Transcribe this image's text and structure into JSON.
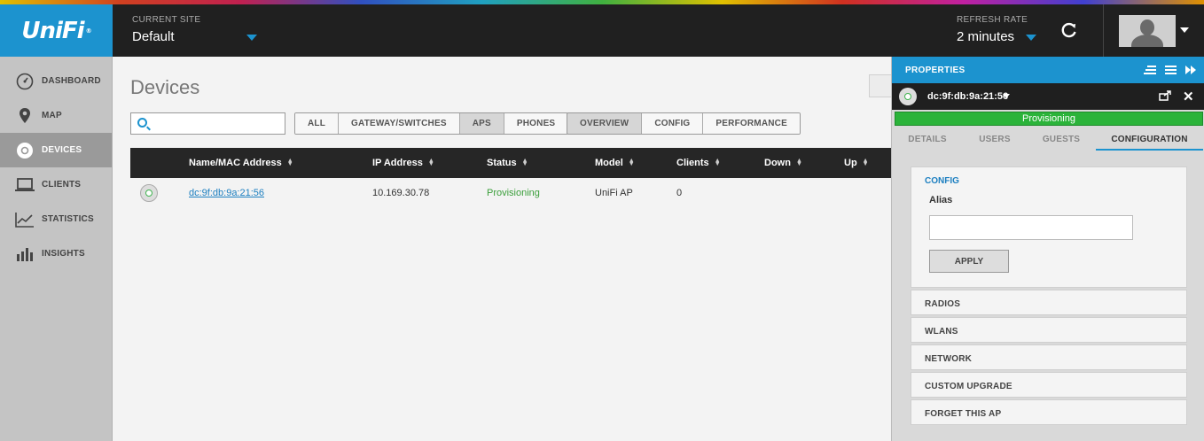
{
  "header": {
    "logo": "UniFi",
    "logo_mark": "®",
    "site_caption": "CURRENT SITE",
    "site_value": "Default",
    "refresh_caption": "REFRESH RATE",
    "refresh_value": "2 minutes",
    "refresh_icon": "refresh-icon",
    "accent": "#1c93cf"
  },
  "sidebar": {
    "items": [
      {
        "label": "DASHBOARD",
        "icon": "dashboard-icon"
      },
      {
        "label": "MAP",
        "icon": "map-pin-icon"
      },
      {
        "label": "DEVICES",
        "icon": "device-icon",
        "active": true
      },
      {
        "label": "CLIENTS",
        "icon": "laptop-icon"
      },
      {
        "label": "STATISTICS",
        "icon": "line-chart-icon"
      },
      {
        "label": "INSIGHTS",
        "icon": "bar-chart-icon"
      }
    ]
  },
  "main": {
    "title": "Devices",
    "search": {
      "placeholder": "",
      "value": ""
    },
    "filters": [
      "ALL",
      "GATEWAY/SWITCHES",
      "APS",
      "PHONES"
    ],
    "filter_selected": "APS",
    "views": [
      "OVERVIEW",
      "CONFIG",
      "PERFORMANCE"
    ],
    "view_selected": "OVERVIEW",
    "columns": [
      "Name/MAC Address",
      "IP Address",
      "Status",
      "Model",
      "Clients",
      "Down",
      "Up"
    ],
    "rows": [
      {
        "name": "dc:9f:db:9a:21:56",
        "ip": "10.169.30.78",
        "status": "Provisioning",
        "model": "UniFi AP",
        "clients": "0",
        "down": "",
        "up": ""
      }
    ]
  },
  "panel": {
    "title": "PROPERTIES",
    "device": "dc:9f:db:9a:21:56",
    "status": "Provisioning",
    "status_color": "#2bb33a",
    "tabs": [
      "DETAILS",
      "USERS",
      "GUESTS",
      "CONFIGURATION"
    ],
    "tab_selected": "CONFIGURATION",
    "config_title": "CONFIG",
    "alias_label": "Alias",
    "alias_value": "",
    "apply_label": "APPLY",
    "sections": [
      "RADIOS",
      "WLANS",
      "NETWORK",
      "CUSTOM UPGRADE",
      "FORGET THIS AP"
    ]
  }
}
